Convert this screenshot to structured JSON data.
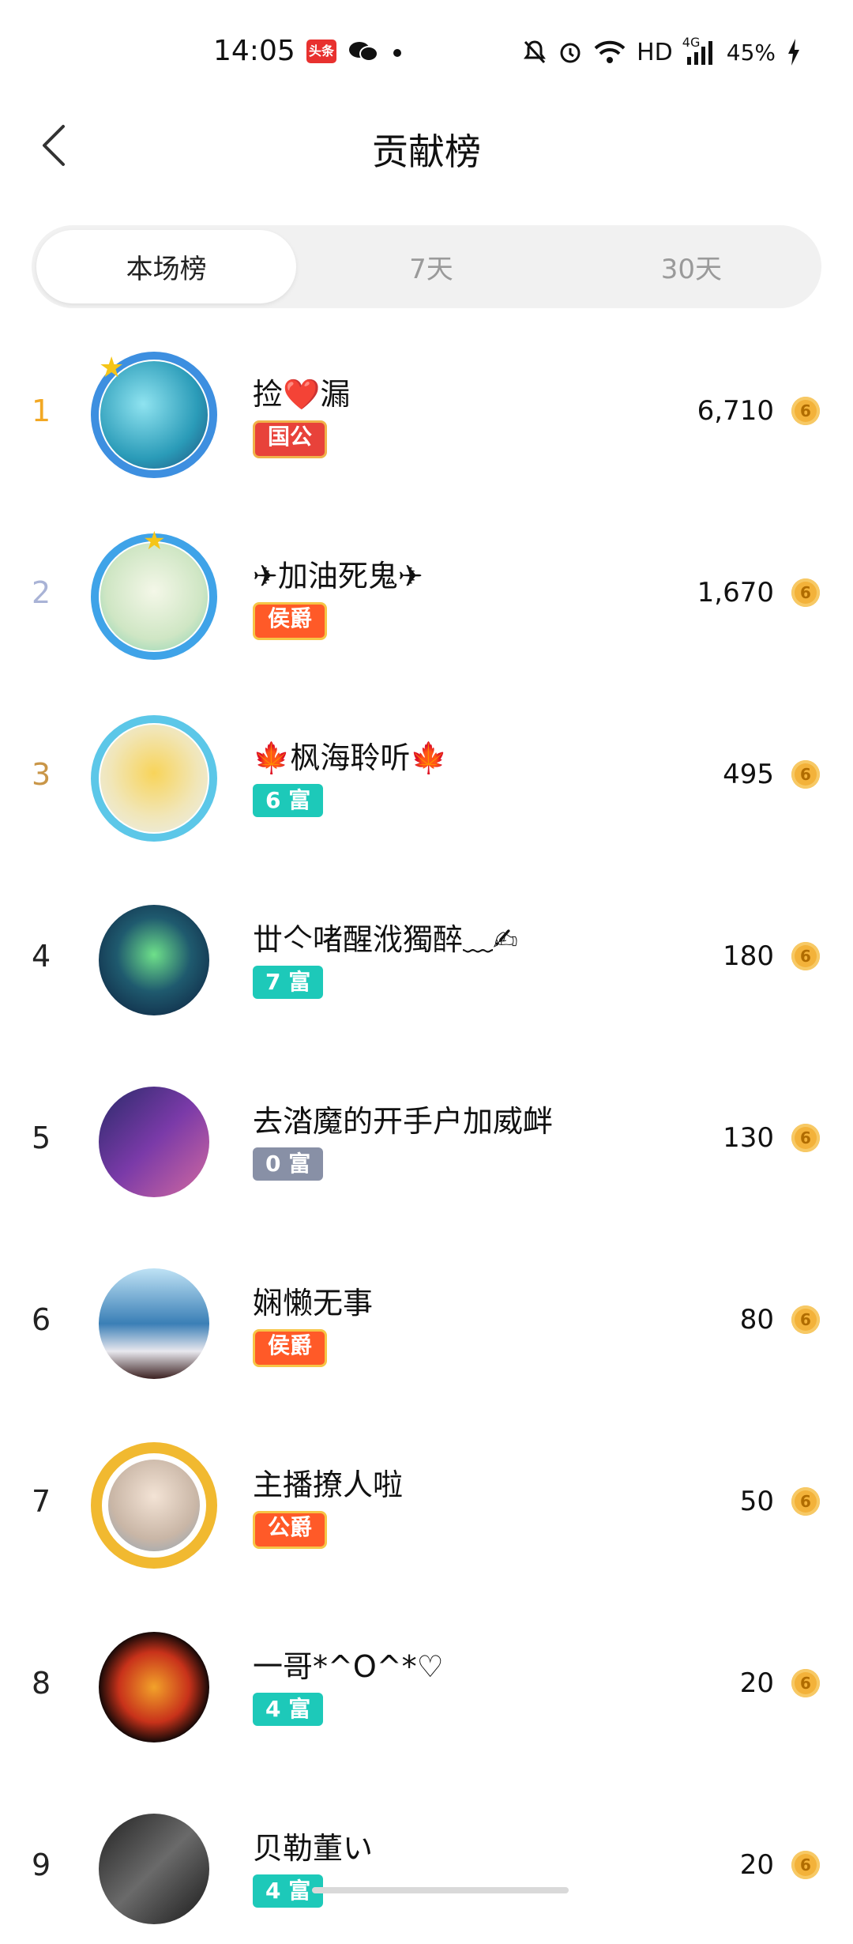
{
  "status": {
    "time": "14:05",
    "app_badge": "头条",
    "hd": "HD",
    "network": "4G",
    "battery": "45%"
  },
  "header": {
    "title": "贡献榜"
  },
  "tabs": [
    {
      "label": "本场榜",
      "active": true
    },
    {
      "label": "7天",
      "active": false
    },
    {
      "label": "30天",
      "active": false
    }
  ],
  "rows": [
    {
      "rank": "1",
      "name": "捡❤️漏",
      "badge": "国公",
      "badge_style": "red",
      "score": "6,710",
      "rank_color": "#f2a824"
    },
    {
      "rank": "2",
      "name": "✈加油死鬼✈",
      "badge": "侯爵",
      "badge_style": "orange",
      "score": "1,670",
      "rank_color": "#a9b3d6"
    },
    {
      "rank": "3",
      "name": "🍁枫海聆听🍁",
      "badge": "6 富",
      "badge_style": "teal",
      "score": "495",
      "rank_color": "#c99648"
    },
    {
      "rank": "4",
      "name": "丗亽啫醒浌獨醉﹏✍",
      "badge": "7 富",
      "badge_style": "teal",
      "score": "180",
      "rank_color": "#222222"
    },
    {
      "rank": "5",
      "name": "去涾魔的开手户加威衅",
      "badge": "0 富",
      "badge_style": "grey",
      "score": "130",
      "rank_color": "#222222"
    },
    {
      "rank": "6",
      "name": "娴懒无事",
      "badge": "侯爵",
      "badge_style": "orange",
      "score": "80",
      "rank_color": "#222222"
    },
    {
      "rank": "7",
      "name": "主播撩人啦",
      "badge": "公爵",
      "badge_style": "orange",
      "score": "50",
      "rank_color": "#222222"
    },
    {
      "rank": "8",
      "name": "一哥*^O^*♡",
      "badge": "4 富",
      "badge_style": "teal",
      "score": "20",
      "rank_color": "#222222"
    },
    {
      "rank": "9",
      "name": "贝勒董い",
      "badge": "4 富",
      "badge_style": "teal",
      "score": "20",
      "rank_color": "#222222"
    }
  ],
  "coin_symbol": "6"
}
